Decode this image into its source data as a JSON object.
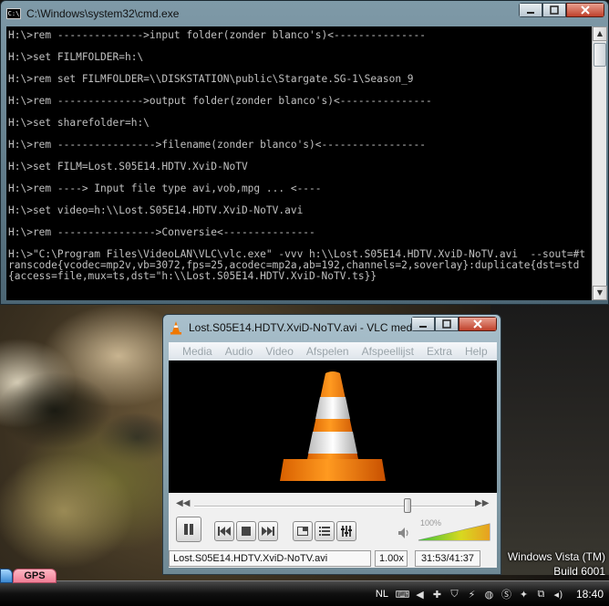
{
  "cmd": {
    "title": "C:\\Windows\\system32\\cmd.exe",
    "icon_label": "C:\\",
    "lines": [
      "H:\\>rem -------------->input folder(zonder blanco's)<---------------",
      "",
      "H:\\>set FILMFOLDER=h:\\",
      "",
      "H:\\>rem set FILMFOLDER=\\\\DISKSTATION\\public\\Stargate.SG-1\\Season_9",
      "",
      "H:\\>rem -------------->output folder(zonder blanco's)<---------------",
      "",
      "H:\\>set sharefolder=h:\\",
      "",
      "H:\\>rem ---------------->filename(zonder blanco's)<-----------------",
      "",
      "H:\\>set FILM=Lost.S05E14.HDTV.XviD-NoTV",
      "",
      "H:\\>rem ----> Input file type avi,vob,mpg ... <----",
      "",
      "H:\\>set video=h:\\\\Lost.S05E14.HDTV.XviD-NoTV.avi",
      "",
      "H:\\>rem ---------------->Conversie<---------------",
      "",
      "H:\\>\"C:\\Program Files\\VideoLAN\\VLC\\vlc.exe\" -vvv h:\\\\Lost.S05E14.HDTV.XviD-NoTV.avi  --sout=#transcode{vcodec=mp2v,vb=3072,fps=25,acodec=mp2a,ab=192,channels=2,soverlay}:duplicate{dst=std{access=file,mux=ts,dst=\"h:\\\\Lost.S05E14.HDTV.XviD-NoTV.ts}}"
    ]
  },
  "vlc": {
    "title": "Lost.S05E14.HDTV.XviD-NoTV.avi - VLC med...",
    "menu": [
      "Media",
      "Audio",
      "Video",
      "Afspelen",
      "Afspeellijst",
      "Extra",
      "Help"
    ],
    "seek_position": 0.76,
    "volume_percent": "100%",
    "volume_level": 1.0,
    "status": {
      "filename": "Lost.S05E14.HDTV.XviD-NoTV.avi",
      "speed": "1.00x",
      "time": "31:53/41:37"
    }
  },
  "desktop": {
    "branding_line1": "Windows Vista (TM)",
    "branding_line2": "Build 6001",
    "gps_tab": "GPS"
  },
  "taskbar": {
    "language": "NL",
    "clock": "18:40"
  },
  "colors": {
    "vlc_orange": "#f07800",
    "close_red": "#c0402a",
    "console_text": "#c0c0c0"
  }
}
